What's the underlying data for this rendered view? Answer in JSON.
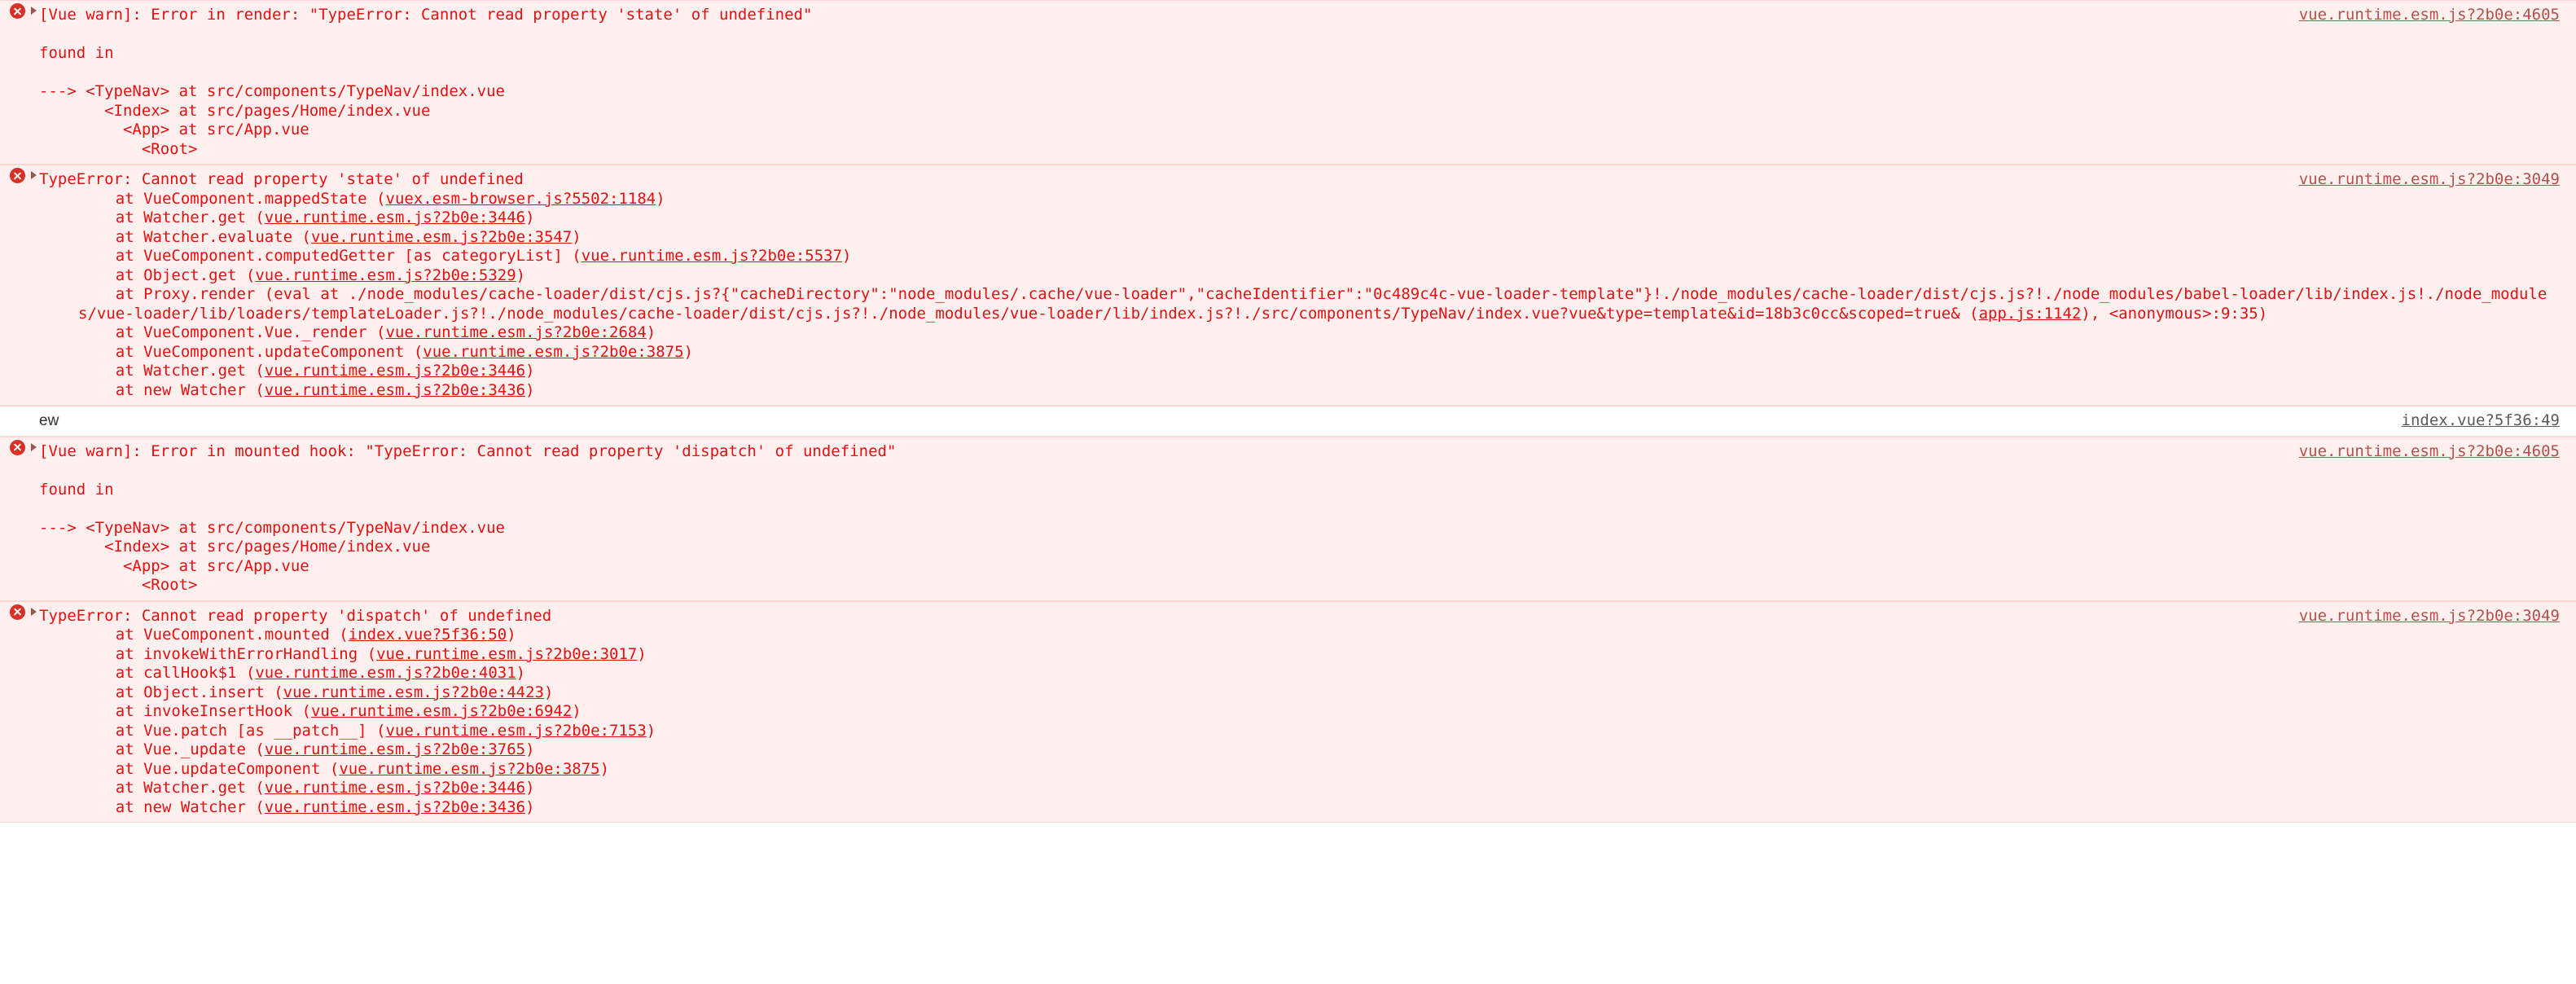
{
  "console": {
    "entries": [
      {
        "kind": "error",
        "icon": "error-circle-icon",
        "expandable": true,
        "message": "[Vue warn]: Error in render: \"TypeError: Cannot read property 'state' of undefined\"",
        "source_link": "vue.runtime.esm.js?2b0e:4605",
        "trace_header": "found in",
        "trace": [
          "---> <TypeNav> at src/components/TypeNav/index.vue",
          "       <Index> at src/pages/Home/index.vue",
          "         <App> at src/App.vue",
          "           <Root>"
        ]
      },
      {
        "kind": "error",
        "icon": "error-circle-icon",
        "expandable": true,
        "message": "TypeError: Cannot read property 'state' of undefined",
        "source_link": "vue.runtime.esm.js?2b0e:3049",
        "stack": [
          {
            "fn": "    at VueComponent.mappedState (",
            "link": "vuex.esm-browser.js?5502:1184",
            "tail": ")"
          },
          {
            "fn": "    at Watcher.get (",
            "link": "vue.runtime.esm.js?2b0e:3446",
            "tail": ")"
          },
          {
            "fn": "    at Watcher.evaluate (",
            "link": "vue.runtime.esm.js?2b0e:3547",
            "tail": ")"
          },
          {
            "fn": "    at VueComponent.computedGetter [as categoryList] (",
            "link": "vue.runtime.esm.js?2b0e:5537",
            "tail": ")"
          },
          {
            "fn": "    at Object.get (",
            "link": "vue.runtime.esm.js?2b0e:5329",
            "tail": ")"
          },
          {
            "fn": "    at Proxy.render (eval at ./node_modules/cache-loader/dist/cjs.js?{\"cacheDirectory\":\"node_modules/.cache/vue-loader\",\"cacheIdentifier\":\"0c489c4c-vue-loader-template\"}!./node_modules/cache-loader/dist/cjs.js?!./node_modules/babel-loader/lib/index.js!./node_modules/vue-loader/lib/loaders/templateLoader.js?!./node_modules/cache-loader/dist/cjs.js?!./node_modules/vue-loader/lib/index.js?!./src/components/TypeNav/index.vue?vue&type=template&id=18b3c0cc&scoped=true& (",
            "link": "app.js:1142",
            "tail": "), <anonymous>:9:35)"
          },
          {
            "fn": "    at VueComponent.Vue._render (",
            "link": "vue.runtime.esm.js?2b0e:2684",
            "tail": ")"
          },
          {
            "fn": "    at VueComponent.updateComponent (",
            "link": "vue.runtime.esm.js?2b0e:3875",
            "tail": ")"
          },
          {
            "fn": "    at Watcher.get (",
            "link": "vue.runtime.esm.js?2b0e:3446",
            "tail": ")"
          },
          {
            "fn": "    at new Watcher (",
            "link": "vue.runtime.esm.js?2b0e:3436",
            "tail": ")"
          }
        ]
      },
      {
        "kind": "log",
        "message": "ew",
        "source_link": "index.vue?5f36:49"
      },
      {
        "kind": "error",
        "icon": "error-circle-icon",
        "expandable": true,
        "message": "[Vue warn]: Error in mounted hook: \"TypeError: Cannot read property 'dispatch' of undefined\"",
        "source_link": "vue.runtime.esm.js?2b0e:4605",
        "trace_header": "found in",
        "trace": [
          "---> <TypeNav> at src/components/TypeNav/index.vue",
          "       <Index> at src/pages/Home/index.vue",
          "         <App> at src/App.vue",
          "           <Root>"
        ]
      },
      {
        "kind": "error",
        "icon": "error-circle-icon",
        "expandable": true,
        "message": "TypeError: Cannot read property 'dispatch' of undefined",
        "source_link": "vue.runtime.esm.js?2b0e:3049",
        "stack": [
          {
            "fn": "    at VueComponent.mounted (",
            "link": "index.vue?5f36:50",
            "tail": ")"
          },
          {
            "fn": "    at invokeWithErrorHandling (",
            "link": "vue.runtime.esm.js?2b0e:3017",
            "tail": ")"
          },
          {
            "fn": "    at callHook$1 (",
            "link": "vue.runtime.esm.js?2b0e:4031",
            "tail": ")"
          },
          {
            "fn": "    at Object.insert (",
            "link": "vue.runtime.esm.js?2b0e:4423",
            "tail": ")"
          },
          {
            "fn": "    at invokeInsertHook (",
            "link": "vue.runtime.esm.js?2b0e:6942",
            "tail": ")"
          },
          {
            "fn": "    at Vue.patch [as __patch__] (",
            "link": "vue.runtime.esm.js?2b0e:7153",
            "tail": ")"
          },
          {
            "fn": "    at Vue._update (",
            "link": "vue.runtime.esm.js?2b0e:3765",
            "tail": ")"
          },
          {
            "fn": "    at Vue.updateComponent (",
            "link": "vue.runtime.esm.js?2b0e:3875",
            "tail": ")"
          },
          {
            "fn": "    at Watcher.get (",
            "link": "vue.runtime.esm.js?2b0e:3446",
            "tail": ")"
          },
          {
            "fn": "    at new Watcher (",
            "link": "vue.runtime.esm.js?2b0e:3436",
            "tail": ")"
          }
        ]
      }
    ]
  },
  "colors": {
    "error_text": "#e61010",
    "error_bg": "#fff0f0",
    "error_border": "#ffd6d6",
    "error_icon": "#d93025",
    "log_text": "#303030",
    "link": "#5a5a5a"
  }
}
